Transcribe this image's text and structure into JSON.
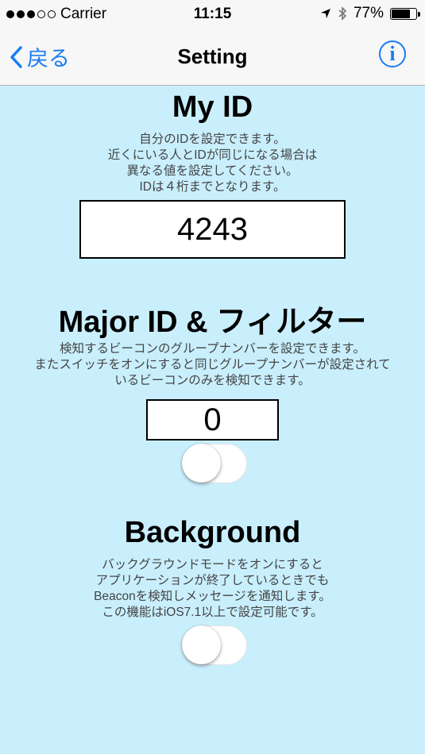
{
  "status": {
    "carrier": "Carrier",
    "time": "11:15",
    "battery": "77%",
    "battery_level": 0.77,
    "signal_bars_filled": 3,
    "signal_bars_total": 5
  },
  "nav": {
    "back_label": "戻る",
    "title": "Setting"
  },
  "my_id": {
    "title": "My ID",
    "desc": [
      "自分のIDを設定できます。",
      "近くにいる人とIDが同じになる場合は",
      "異なる値を設定してください。",
      "IDは４桁までとなります。"
    ],
    "value": "4243"
  },
  "major": {
    "title": "Major ID & フィルター",
    "desc": [
      "検知するビーコンのグループナンバーを設定できます。",
      "またスイッチをオンにすると同じグループナンバーが設定されて",
      "いるビーコンのみを検知できます。"
    ],
    "value": "0",
    "filter_on": false
  },
  "background": {
    "title": "Background",
    "desc": [
      "バックグラウンドモードをオンにすると",
      "アプリケーションが終了しているときでも",
      "Beaconを検知しメッセージを通知します。",
      "この機能はiOS7.1以上で設定可能です。"
    ],
    "enabled": false
  }
}
